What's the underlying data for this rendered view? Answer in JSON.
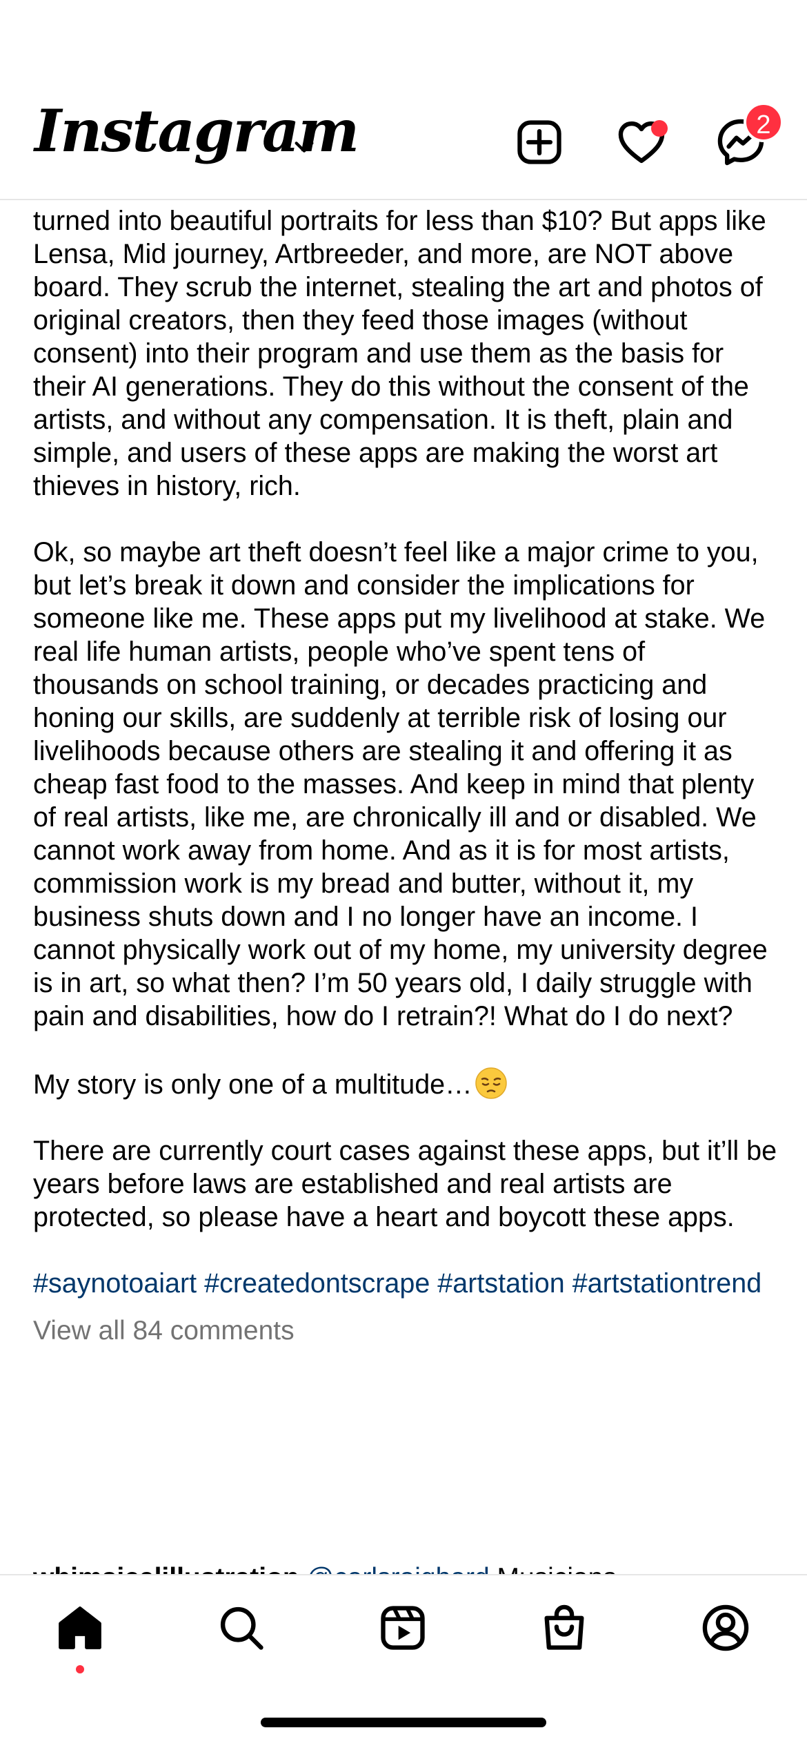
{
  "header": {
    "logo_text": "Instagram",
    "notification_count": "2"
  },
  "post": {
    "paragraphs": [
      "turned into beautiful portraits for less than $10? But apps like Lensa, Mid journey, Artbreeder, and more, are NOT above board. They scrub the internet, stealing the art and photos of original creators, then they feed those images (without consent) into their program and use them as the basis for their AI generations. They do this without the consent of the artists, and without any compensation. It is theft, plain and simple, and users of these apps are making the worst art thieves in history, rich.",
      "Ok, so maybe art theft doesn’t feel like a major crime to you, but let’s break it down and consider the implications for someone like me. These apps put my livelihood at stake. We real life human artists, people who’ve spent tens of thousands on school training, or decades practicing and honing our skills, are suddenly at terrible risk of losing our livelihoods because others are stealing it and offering it as cheap fast food to the masses. And keep in mind that plenty of real artists, like me, are chronically ill and or disabled. We cannot work away from home. And as it is for most artists, commission work is my bread and butter, without it, my business shuts down and I no longer have an income. I cannot physically work out of my home, my university degree is in art, so what then? I’m 50 years old, I daily struggle with pain and disabilities, how do I retrain?! What do I do next?",
      "My story is only one of a multitude…",
      "There are currently court cases against these apps, but it’ll be years before laws are established and real artists are protected, so please have a heart and boycott these apps."
    ],
    "hashtags": "#saynotoaiart #createdontscrape #artstation #artstationtrend",
    "view_comments": "View all 84 comments",
    "comment_peek": {
      "username": "whimsicalillustration",
      "mention": "@carlsraighard",
      "text": "Musicians"
    }
  },
  "colors": {
    "accent_red": "#ff3040",
    "link_blue": "#00376b",
    "muted_gray": "#737373"
  },
  "icons": {
    "header": [
      "chevron-down-icon",
      "new-post-icon",
      "heart-icon",
      "messenger-icon"
    ],
    "tabbar": [
      "home-icon",
      "search-icon",
      "reels-icon",
      "shop-icon",
      "profile-icon"
    ]
  }
}
